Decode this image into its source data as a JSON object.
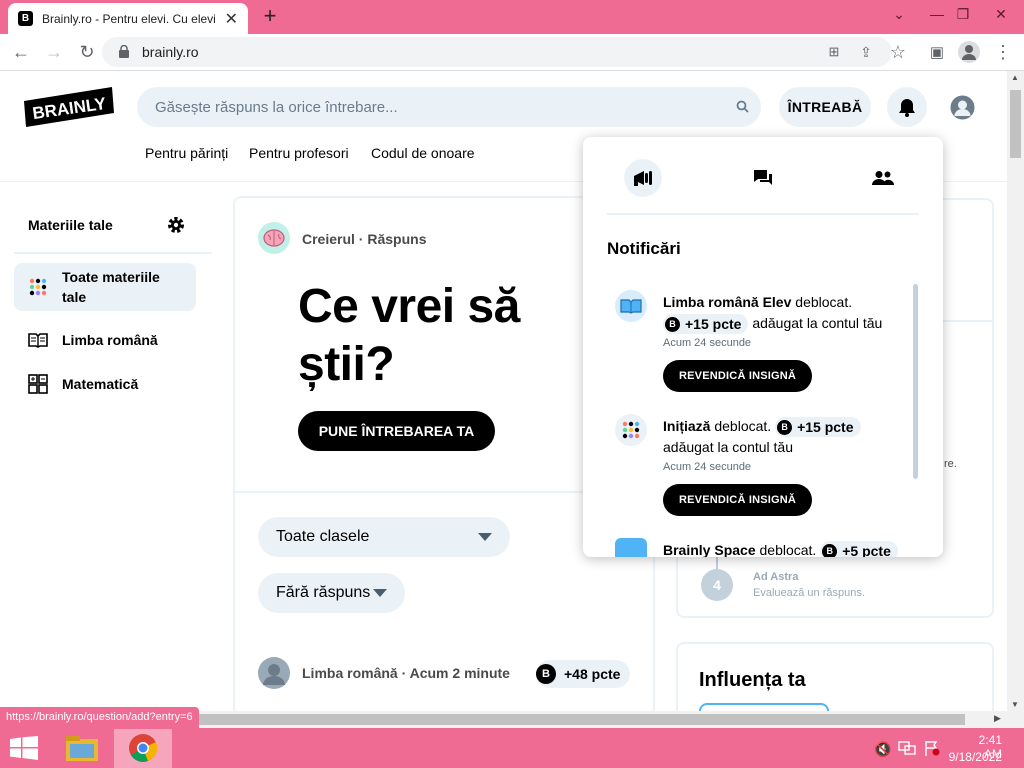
{
  "browser": {
    "tab_title": "Brainly.ro - Pentru elevi. Cu elevi.",
    "url": "brainly.ro",
    "status_url": "https://brainly.ro/question/add?entry=6"
  },
  "header": {
    "logo_text": "BRAINLY",
    "search_placeholder": "Găsește răspuns la orice întrebare...",
    "ask_label": "ÎNTREABĂ",
    "nav": [
      "Pentru părinți",
      "Pentru profesori",
      "Codul de onoare"
    ]
  },
  "sidebar": {
    "title": "Materiile tale",
    "items": [
      {
        "label": "Toate materiile tale",
        "icon": "dots-grid-icon",
        "active": true
      },
      {
        "label": "Limba română",
        "icon": "open-book-icon",
        "active": false
      },
      {
        "label": "Matematică",
        "icon": "math-icon",
        "active": false
      }
    ]
  },
  "hero": {
    "badge": "Creierul · Răspuns",
    "title": "Ce vrei să știi?",
    "cta": "PUNE ÎNTREBAREA TA"
  },
  "filters": {
    "grade": "Toate clasele",
    "status": "Fără răspuns"
  },
  "feed": {
    "meta": "Limba română · Acum 2 minute",
    "points": "+48 pcte",
    "coin": "B"
  },
  "right_column": {
    "rank_number": "4",
    "rank_name": "Ad Astra",
    "rank_sub": "Evaluează un răspuns.",
    "fragment": "re.",
    "influence_title": "Influența ta"
  },
  "notifications": {
    "title": "Notificări",
    "items": [
      {
        "subject": "Limba română Elev",
        "action": "deblocat.",
        "points": "+15 pcte",
        "tail": "adăugat la contul tău",
        "time": "Acum 24 secunde",
        "button": "REVENDICĂ INSIGNĂ"
      },
      {
        "subject": "Inițiază",
        "action": "deblocat.",
        "points": "+15 pcte",
        "tail": "adăugat la contul tău",
        "time": "Acum 24 secunde",
        "button": "REVENDICĂ INSIGNĂ"
      },
      {
        "subject": "Brainly Space",
        "action": "deblocat.",
        "points": "+5 pcte"
      }
    ]
  },
  "taskbar": {
    "time": "2:41 AM",
    "date": "9/18/2022"
  }
}
